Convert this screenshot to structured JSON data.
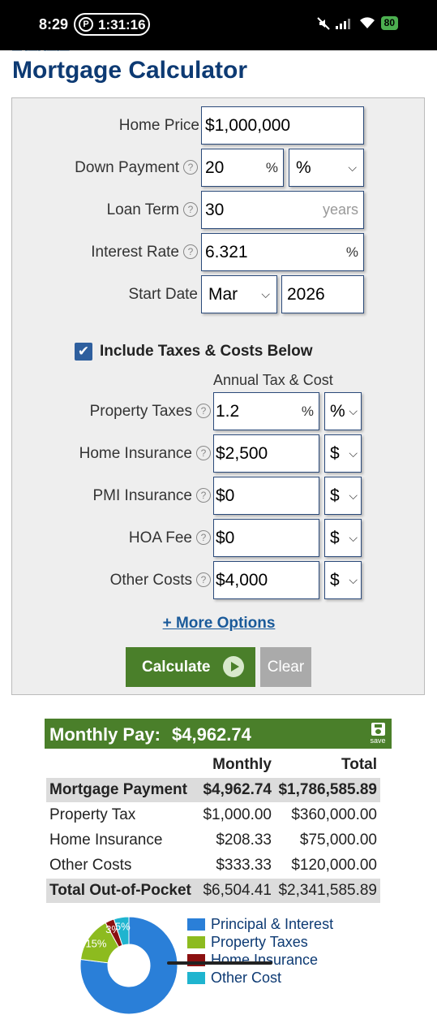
{
  "status_bar": {
    "time": "8:29",
    "timer": "1:31:16",
    "battery": "80"
  },
  "page": {
    "title": "Mortgage Calculator"
  },
  "form": {
    "home_price": {
      "label": "Home Price",
      "value": "$1,000,000"
    },
    "down_payment": {
      "label": "Down Payment",
      "value": "20",
      "suffix": "%",
      "unit": "%"
    },
    "loan_term": {
      "label": "Loan Term",
      "value": "30",
      "suffix": "years"
    },
    "interest_rate": {
      "label": "Interest Rate",
      "value": "6.321",
      "suffix": "%"
    },
    "start_date": {
      "label": "Start Date",
      "month": "Mar",
      "year": "2026"
    },
    "include_taxes": {
      "label": "Include Taxes & Costs Below",
      "checked": true
    },
    "annual_header": "Annual Tax & Cost",
    "costs": [
      {
        "label": "Property Taxes",
        "value": "1.2",
        "suffix": "%",
        "unit": "%"
      },
      {
        "label": "Home Insurance",
        "value": "$2,500",
        "suffix": "",
        "unit": "$"
      },
      {
        "label": "PMI Insurance",
        "value": "$0",
        "suffix": "",
        "unit": "$"
      },
      {
        "label": "HOA Fee",
        "value": "$0",
        "suffix": "",
        "unit": "$"
      },
      {
        "label": "Other Costs",
        "value": "$4,000",
        "suffix": "",
        "unit": "$"
      }
    ],
    "more_options": "+ More Options",
    "calculate": "Calculate",
    "clear": "Clear"
  },
  "results": {
    "monthly_pay_label": "Monthly Pay:",
    "monthly_pay_value": "$4,962.74",
    "save_label": "save",
    "col_monthly": "Monthly",
    "col_total": "Total",
    "rows": [
      {
        "name": "Mortgage Payment",
        "monthly": "$4,962.74",
        "total": "$1,786,585.89",
        "shaded": true
      },
      {
        "name": "Property Tax",
        "monthly": "$1,000.00",
        "total": "$360,000.00",
        "shaded": false
      },
      {
        "name": "Home Insurance",
        "monthly": "$208.33",
        "total": "$75,000.00",
        "shaded": false
      },
      {
        "name": "Other Costs",
        "monthly": "$333.33",
        "total": "$120,000.00",
        "shaded": false
      },
      {
        "name": "Total Out-of-Pocket",
        "monthly": "$6,504.41",
        "total": "$2,341,585.89",
        "shaded": true
      }
    ]
  },
  "chart_data": {
    "type": "pie",
    "categories": [
      "Principal & Interest",
      "Property Taxes",
      "Home Insurance",
      "Other Cost"
    ],
    "values": [
      77,
      15,
      3,
      5
    ],
    "data_labels": [
      "",
      "15%",
      "3%",
      "5%"
    ],
    "colors": [
      "#2a7fd8",
      "#8dbb1f",
      "#8b1010",
      "#1fb4cf"
    ],
    "legend_placement": "right"
  }
}
